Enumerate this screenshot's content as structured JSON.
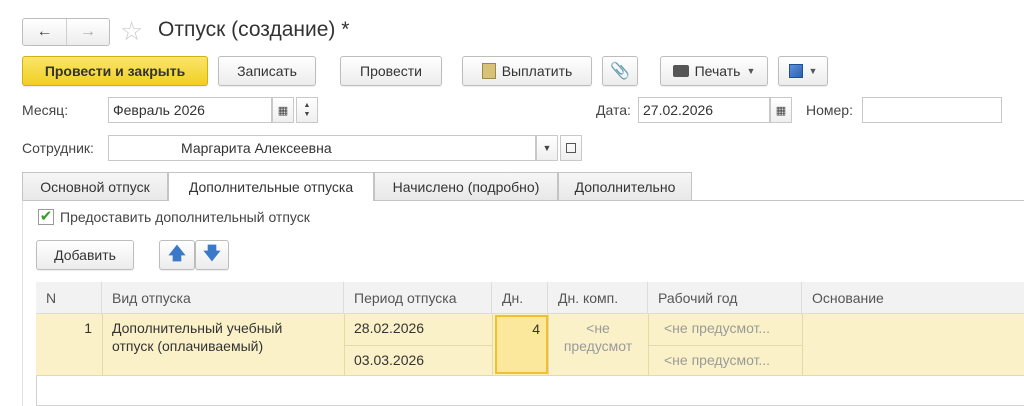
{
  "window": {
    "title": "Отпуск (создание) *"
  },
  "toolbar": {
    "post_close": "Провести и закрыть",
    "save": "Записать",
    "post": "Провести",
    "pay": "Выплатить",
    "print": "Печать"
  },
  "form": {
    "month_label": "Месяц:",
    "month_value": "Февраль 2026",
    "date_label": "Дата:",
    "date_value": "27.02.2026",
    "number_label": "Номер:",
    "number_value": "",
    "employee_label": "Сотрудник:",
    "employee_value": "Маргарита Алексеевна"
  },
  "tabs": [
    {
      "label": "Основной отпуск"
    },
    {
      "label": "Дополнительные отпуска"
    },
    {
      "label": "Начислено (подробно)"
    },
    {
      "label": "Дополнительно"
    }
  ],
  "extra": {
    "checkbox_label": "Предоставить дополнительный отпуск",
    "add_button": "Добавить"
  },
  "table": {
    "headers": [
      "N",
      "Вид отпуска",
      "Период отпуска",
      "Дн.",
      "Дн. комп.",
      "Рабочий год",
      "Основание"
    ],
    "row": {
      "n": "1",
      "type_line1": "Дополнительный учебный",
      "type_line2": "отпуск (оплачиваемый)",
      "period_from": "28.02.2026",
      "period_to": "03.03.2026",
      "days": "4",
      "comp_line1": "<не",
      "comp_line2": "предусмот",
      "year_from": "<не предусмот...",
      "year_to": "<не предусмот...",
      "basis": ""
    }
  },
  "colors": {
    "accent": "#f0cf22",
    "row_highlight": "#fbf1c8",
    "cell_border": "#f0c030"
  }
}
